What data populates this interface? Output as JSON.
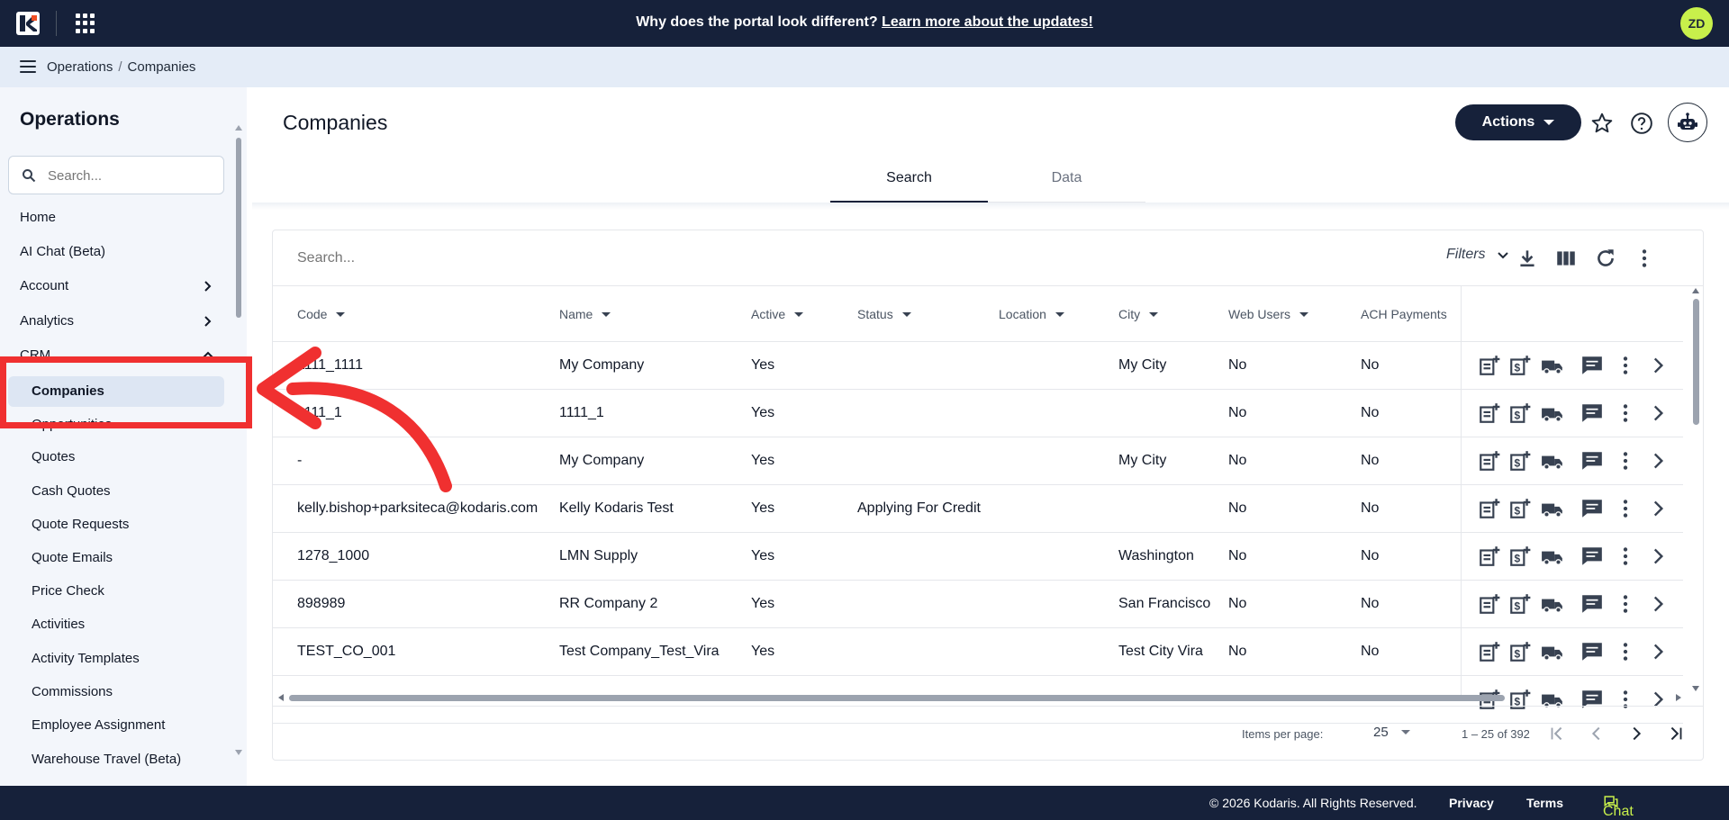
{
  "topbar": {
    "announcement_text": "Why does the portal look different?",
    "announcement_link": "Learn more about the updates!",
    "avatar_initials": "ZD",
    "accent_color": "#c8f04b",
    "background_color": "#16213a"
  },
  "breadcrumb": {
    "items": [
      "Operations",
      "Companies"
    ],
    "separator": "/"
  },
  "sidebar": {
    "title": "Operations",
    "search_placeholder": "Search...",
    "items": [
      {
        "label": "Home"
      },
      {
        "label": "AI Chat (Beta)"
      },
      {
        "label": "Account",
        "expandable": true
      },
      {
        "label": "Analytics",
        "expandable": true
      },
      {
        "label": "CRM",
        "expanded": true
      }
    ],
    "crm_items": [
      {
        "label": "Companies",
        "active": true
      },
      {
        "label": "Opportunities"
      },
      {
        "label": "Quotes"
      },
      {
        "label": "Cash Quotes"
      },
      {
        "label": "Quote Requests"
      },
      {
        "label": "Quote Emails"
      },
      {
        "label": "Price Check"
      },
      {
        "label": "Activities"
      },
      {
        "label": "Activity Templates"
      },
      {
        "label": "Commissions"
      },
      {
        "label": "Employee Assignment"
      },
      {
        "label": "Warehouse Travel (Beta)"
      }
    ]
  },
  "page": {
    "title": "Companies",
    "actions_label": "Actions",
    "tabs": [
      {
        "label": "Search",
        "active": true
      },
      {
        "label": "Data",
        "active": false
      }
    ]
  },
  "table": {
    "search_placeholder": "Search...",
    "filters_label": "Filters",
    "columns": [
      "Code",
      "Name",
      "Active",
      "Status",
      "Location",
      "City",
      "Web Users",
      "ACH Payments"
    ],
    "rows": [
      {
        "code": "1111_1111",
        "name": "My Company",
        "active": "Yes",
        "status": "",
        "location": "",
        "city": "My City",
        "web_users": "No",
        "ach": "No"
      },
      {
        "code": "1111_1",
        "name": "1111_1",
        "active": "Yes",
        "status": "",
        "location": "",
        "city": "",
        "web_users": "No",
        "ach": "No"
      },
      {
        "code": "-",
        "name": "My Company",
        "active": "Yes",
        "status": "",
        "location": "",
        "city": "My City",
        "web_users": "No",
        "ach": "No"
      },
      {
        "code": "kelly.bishop+parksiteca@kodaris.com",
        "name": "Kelly Kodaris Test",
        "active": "Yes",
        "status": "Applying For Credit",
        "location": "",
        "city": "",
        "web_users": "No",
        "ach": "No"
      },
      {
        "code": "1278_1000",
        "name": "LMN Supply",
        "active": "Yes",
        "status": "",
        "location": "",
        "city": "Washington",
        "web_users": "No",
        "ach": "No"
      },
      {
        "code": "898989",
        "name": "RR Company 2",
        "active": "Yes",
        "status": "",
        "location": "",
        "city": "San Francisco",
        "web_users": "No",
        "ach": "No"
      },
      {
        "code": "TEST_CO_001",
        "name": "Test Company_Test_Vira",
        "active": "Yes",
        "status": "",
        "location": "",
        "city": "Test City Vira",
        "web_users": "No",
        "ach": "No"
      }
    ],
    "row_action_icons": [
      "add-note-icon",
      "add-payment-icon",
      "shipping-truck-icon",
      "comment-icon",
      "more-vert-icon",
      "chevron-right-icon"
    ]
  },
  "pagination": {
    "items_per_page_label": "Items per page:",
    "page_size": "25",
    "range_text": "1 – 25 of 392"
  },
  "footer": {
    "copyright": "© 2026 Kodaris. All Rights Reserved.",
    "privacy": "Privacy",
    "terms": "Terms",
    "chat": "Chat with us"
  },
  "annotation": {
    "color": "#f03030"
  }
}
